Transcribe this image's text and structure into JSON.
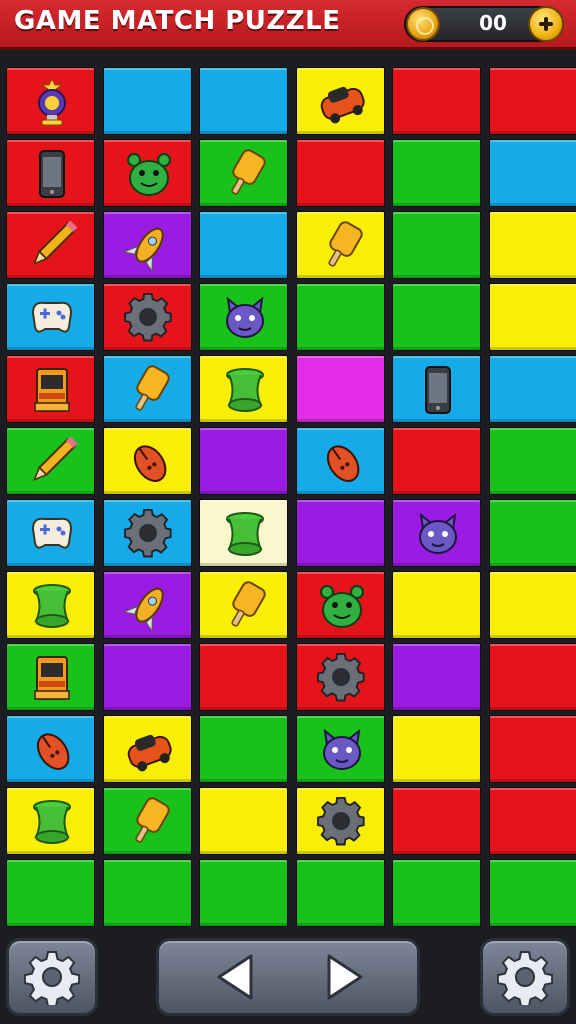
{
  "header": {
    "title": "GAME MATCH PUZZLE",
    "coins": "00",
    "coin_icon": "gold-coin-icon",
    "add_icon": "plus-icon"
  },
  "colors": {
    "R": "#e5141a",
    "B": "#15abe8",
    "Y": "#f9ef06",
    "G": "#18c21a",
    "P": "#9a1ce2",
    "M": "#e12ee6",
    "C": "#fbf7cc"
  },
  "board": {
    "rows": [
      [
        {
          "c": "R",
          "i": "trophy"
        },
        {
          "c": "B"
        },
        {
          "c": "B"
        },
        {
          "c": "Y",
          "i": "car"
        },
        {
          "c": "R"
        },
        {
          "c": "R"
        }
      ],
      [
        {
          "c": "R",
          "i": "phone"
        },
        {
          "c": "R",
          "i": "bear"
        },
        {
          "c": "G",
          "i": "popsicle"
        },
        {
          "c": "R"
        },
        {
          "c": "G"
        },
        {
          "c": "B"
        }
      ],
      [
        {
          "c": "R",
          "i": "pencil"
        },
        {
          "c": "P",
          "i": "rocket"
        },
        {
          "c": "B"
        },
        {
          "c": "Y",
          "i": "popsicle"
        },
        {
          "c": "G"
        },
        {
          "c": "Y"
        }
      ],
      [
        {
          "c": "B",
          "i": "gamepad"
        },
        {
          "c": "R",
          "i": "gear"
        },
        {
          "c": "G",
          "i": "cat"
        },
        {
          "c": "G"
        },
        {
          "c": "G"
        },
        {
          "c": "Y"
        }
      ],
      [
        {
          "c": "R",
          "i": "arcade"
        },
        {
          "c": "B",
          "i": "popsicle"
        },
        {
          "c": "Y",
          "i": "spool"
        },
        {
          "c": "M"
        },
        {
          "c": "B",
          "i": "phone"
        },
        {
          "c": "B"
        }
      ],
      [
        {
          "c": "G",
          "i": "pencil"
        },
        {
          "c": "Y",
          "i": "mouse"
        },
        {
          "c": "P"
        },
        {
          "c": "B",
          "i": "mouse"
        },
        {
          "c": "R"
        },
        {
          "c": "G"
        }
      ],
      [
        {
          "c": "B",
          "i": "gamepad"
        },
        {
          "c": "B",
          "i": "gear"
        },
        {
          "c": "C",
          "i": "spool"
        },
        {
          "c": "P"
        },
        {
          "c": "P",
          "i": "cat"
        },
        {
          "c": "G"
        }
      ],
      [
        {
          "c": "Y",
          "i": "spool"
        },
        {
          "c": "P",
          "i": "rocket"
        },
        {
          "c": "Y",
          "i": "popsicle"
        },
        {
          "c": "R",
          "i": "bear"
        },
        {
          "c": "Y"
        },
        {
          "c": "Y"
        }
      ],
      [
        {
          "c": "G",
          "i": "arcade"
        },
        {
          "c": "P"
        },
        {
          "c": "R"
        },
        {
          "c": "R",
          "i": "gear"
        },
        {
          "c": "P"
        },
        {
          "c": "R"
        }
      ],
      [
        {
          "c": "B",
          "i": "mouse"
        },
        {
          "c": "Y",
          "i": "car"
        },
        {
          "c": "G"
        },
        {
          "c": "G",
          "i": "cat"
        },
        {
          "c": "Y"
        },
        {
          "c": "R"
        }
      ],
      [
        {
          "c": "Y",
          "i": "spool"
        },
        {
          "c": "G",
          "i": "popsicle"
        },
        {
          "c": "Y"
        },
        {
          "c": "Y",
          "i": "gear"
        },
        {
          "c": "R"
        },
        {
          "c": "R"
        }
      ],
      [
        {
          "c": "G"
        },
        {
          "c": "G"
        },
        {
          "c": "G"
        },
        {
          "c": "G"
        },
        {
          "c": "G"
        },
        {
          "c": "G"
        }
      ]
    ]
  },
  "controls": {
    "left_button_icon": "gear-icon",
    "prev_icon": "triangle-left-icon",
    "next_icon": "triangle-right-icon",
    "right_button_icon": "gear-icon"
  }
}
